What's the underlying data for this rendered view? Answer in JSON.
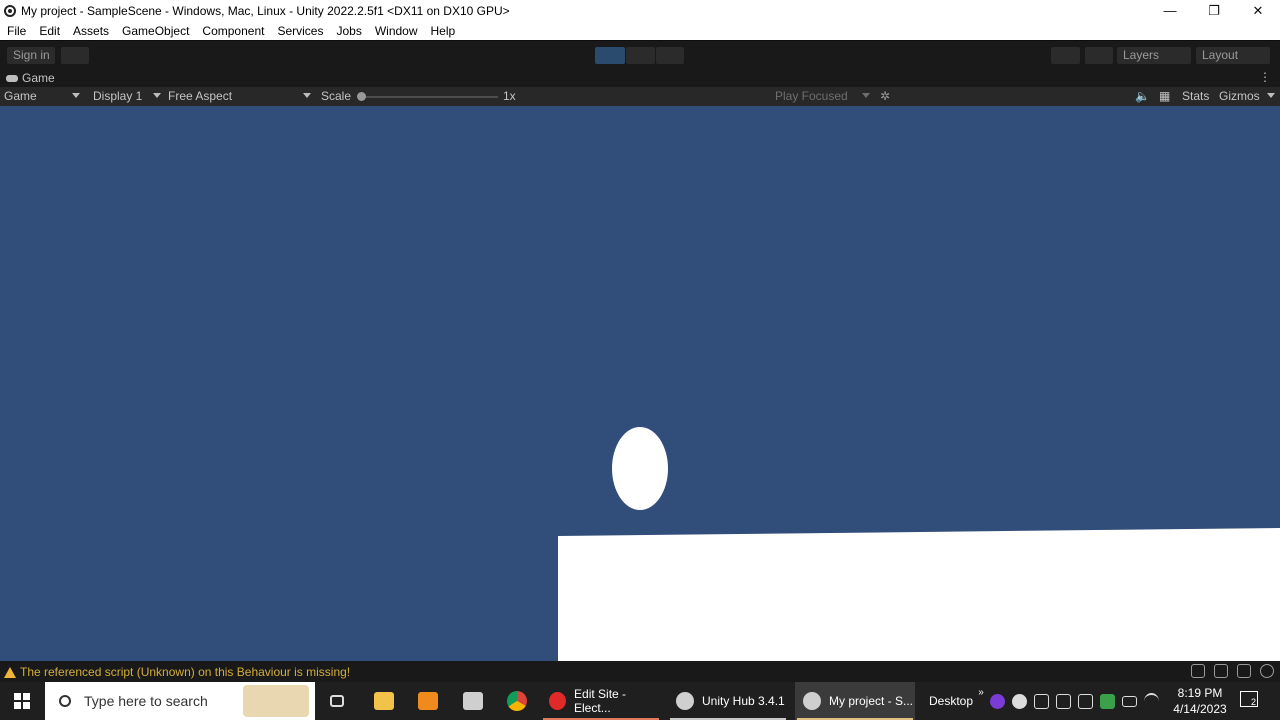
{
  "window": {
    "title": "My project - SampleScene - Windows, Mac, Linux - Unity 2022.2.5f1 <DX11 on DX10 GPU>",
    "controls": {
      "minimize": "—",
      "restore": "❐",
      "close": "✕"
    }
  },
  "menu": [
    "File",
    "Edit",
    "Assets",
    "GameObject",
    "Component",
    "Services",
    "Jobs",
    "Window",
    "Help"
  ],
  "toolbar": {
    "sign_in": "Sign in",
    "layers": "Layers",
    "layout": "Layout",
    "play_button_color": "#2a4a6e"
  },
  "game_tab": {
    "label": "Game",
    "kebab": "⋮"
  },
  "game_controls": {
    "mode": "Game",
    "display": "Display 1",
    "aspect": "Free Aspect",
    "scale_label": "Scale",
    "scale_value": "1x",
    "play_focused": "Play Focused",
    "stats": "Stats",
    "gizmos": "Gizmos"
  },
  "viewport": {
    "background": "#314d79",
    "objects": [
      "ball",
      "ground"
    ]
  },
  "status": {
    "message": "The referenced script (Unknown) on this Behaviour is missing!",
    "color": "#d2ad3c"
  },
  "taskbar": {
    "search_placeholder": "Type here to search",
    "apps": [
      {
        "label": "Edit Site - Elect...",
        "icon": "opera-icon",
        "color": "#e02a2a"
      },
      {
        "label": "Unity Hub 3.4.1",
        "icon": "unity-hub-icon",
        "color": "#cfcfcf"
      },
      {
        "label": "My project - S...",
        "icon": "unity-icon",
        "color": "#cfcfcf"
      }
    ],
    "desktop": "Desktop",
    "time": "8:19 PM",
    "date": "4/14/2023",
    "notifications": "2"
  }
}
